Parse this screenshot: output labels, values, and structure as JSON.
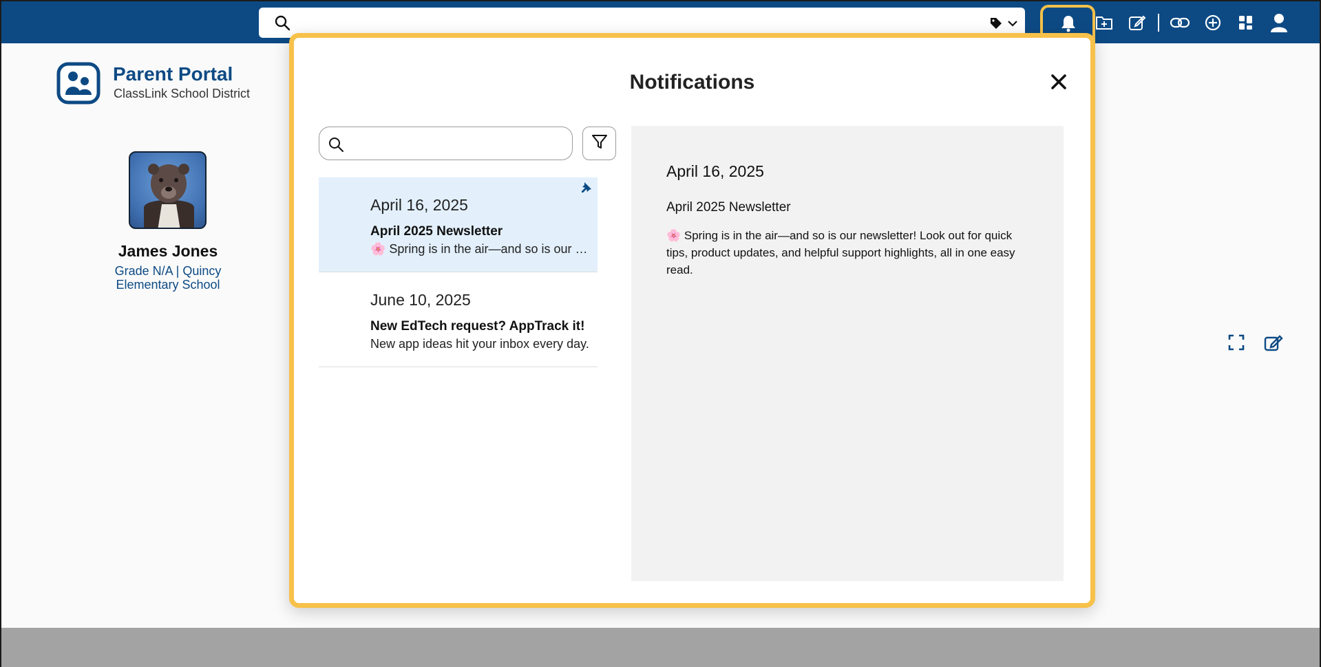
{
  "topbar": {
    "search_placeholder": "",
    "icons": [
      "search-icon",
      "tag-icon",
      "chevron-down-icon",
      "bell-icon",
      "folder-add-icon",
      "edit-icon",
      "link-icon",
      "plus-circle-icon",
      "apps-icon",
      "user-icon"
    ]
  },
  "brand": {
    "title": "Parent Portal",
    "subtitle": "ClassLink School District"
  },
  "profile": {
    "name": "James Jones",
    "grade_line": "Grade N/A | Quincy",
    "school_line": "Elementary School"
  },
  "notifications": {
    "title": "Notifications",
    "search_placeholder": "",
    "items": [
      {
        "date": "April 16, 2025",
        "title": "April 2025 Newsletter",
        "preview": "🌸 Spring is in the air—and so is our newsletter!",
        "pinned": true
      },
      {
        "date": "June 10, 2025",
        "title": "New EdTech request? AppTrack it!",
        "preview": "New app ideas hit your inbox every day.",
        "pinned": false
      }
    ],
    "detail": {
      "date": "April 16, 2025",
      "title": "April 2025 Newsletter",
      "body": "🌸 Spring is in the air—and so is our newsletter! Look out for quick tips, product updates, and helpful support highlights, all in one easy read."
    }
  },
  "colors": {
    "header_blue": "#0d4a84",
    "highlight_yellow": "#f7c14a",
    "selected_bg": "#e3f0fc",
    "detail_bg": "#f2f2f2"
  }
}
